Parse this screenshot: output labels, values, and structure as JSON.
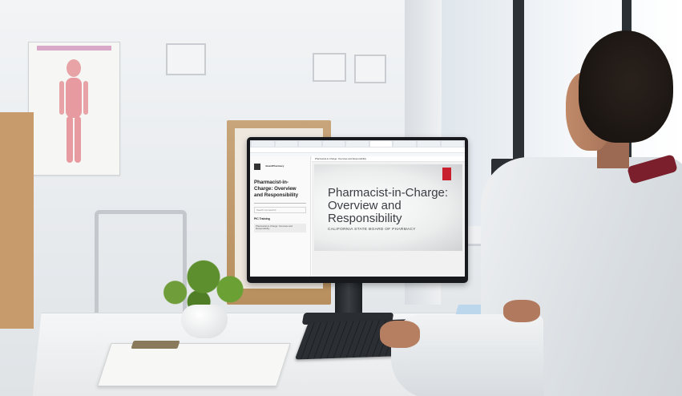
{
  "browser": {
    "tab_count": 9,
    "active_tab_index": 5
  },
  "course": {
    "organization": "BoardPharmacy",
    "title": "Pharmacist-in-Charge: Overview and Responsibility",
    "progress": "0% complete",
    "search_placeholder": "Search Course/Unit",
    "module_label": "PIC Training",
    "lesson_label": "Pharmacist-in-Charge: Overview and Responsibility"
  },
  "lesson_header": "Pharmacist-in-Charge: Overview and Responsibility",
  "slide": {
    "title": "Pharmacist-in-Charge: Overview and Responsibility",
    "subtitle": "CALIFORNIA STATE BOARD OF PHARMACY",
    "accent_color": "#c8202e"
  },
  "colors": {
    "coat_collar": "#7a1f2b",
    "plant": "#5e8f2e",
    "monitor_bezel": "#17191c"
  },
  "icons": [
    "monitor",
    "keyboard",
    "mouse",
    "potted-plant",
    "clipboard",
    "pen-cup"
  ]
}
